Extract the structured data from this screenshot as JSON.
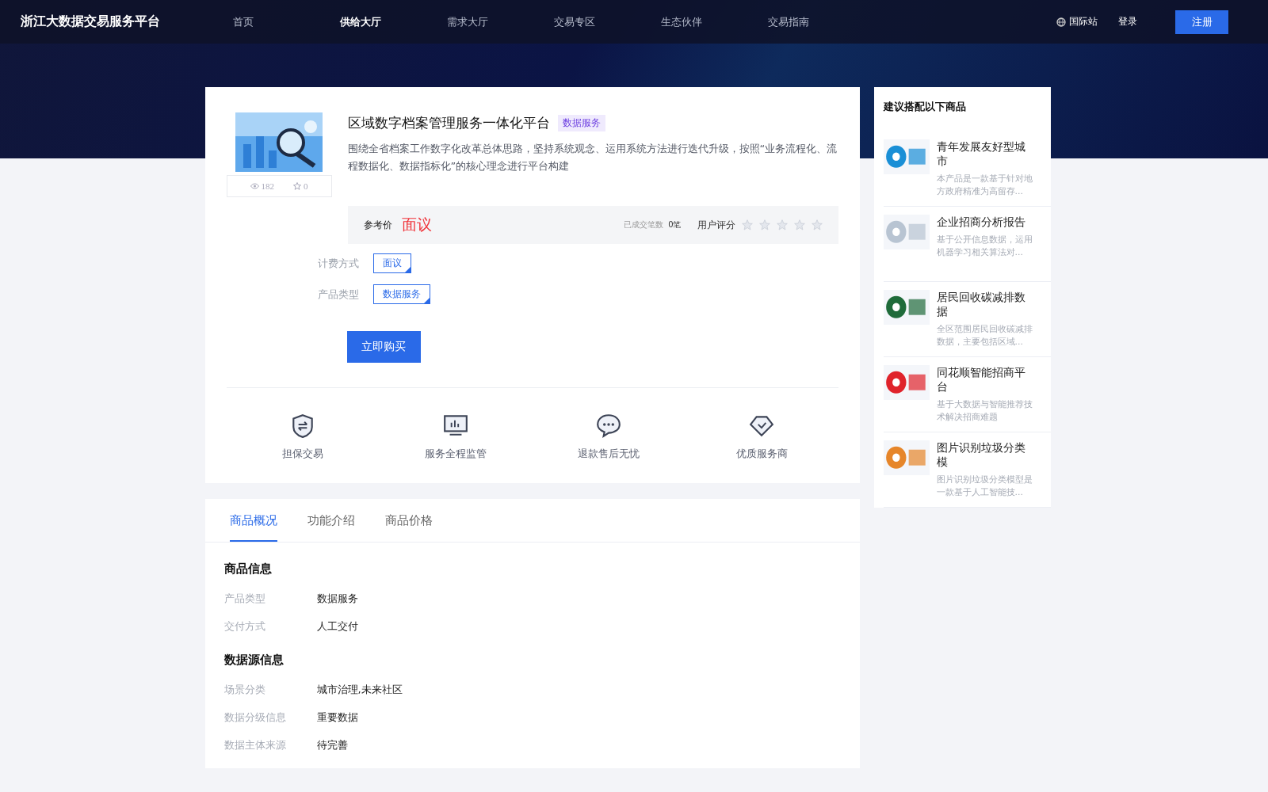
{
  "header": {
    "logo": "浙江大数据交易服务平台",
    "nav": [
      {
        "label": "首页",
        "selected": false
      },
      {
        "label": "供给大厅",
        "selected": true
      },
      {
        "label": "需求大厅",
        "selected": false
      },
      {
        "label": "交易专区",
        "selected": false
      },
      {
        "label": "生态伙伴",
        "selected": false
      },
      {
        "label": "交易指南",
        "selected": false
      }
    ],
    "intl": "国际站",
    "login": "登录",
    "register": "注册"
  },
  "product": {
    "views": "182",
    "favorites": "0",
    "title": "区域数字档案管理服务一体化平台",
    "badge": "数据服务",
    "description": "围绕全省档案工作数字化改革总体思路，坚持系统观念、运用系统方法进行迭代升级，按照“业务流程化、流程数据化、数据指标化”的核心理念进行平台构建",
    "price_label": "参考价",
    "price": "面议",
    "deals_label": "已成交笔数",
    "deals": "0笔",
    "rating_label": "用户评分",
    "stars": 0,
    "options": [
      {
        "label": "计费方式",
        "value": "面议"
      },
      {
        "label": "产品类型",
        "value": "数据服务"
      }
    ],
    "buy": "立即购买",
    "features": [
      {
        "kind": "shield",
        "label": "担保交易"
      },
      {
        "kind": "monitor",
        "label": "服务全程监管"
      },
      {
        "kind": "chat",
        "label": "退款售后无忧"
      },
      {
        "kind": "diamond",
        "label": "优质服务商"
      }
    ]
  },
  "details": {
    "tabs": [
      {
        "label": "商品概况",
        "selected": true
      },
      {
        "label": "功能介绍",
        "selected": false
      },
      {
        "label": "商品价格",
        "selected": false
      }
    ],
    "sections": [
      {
        "title": "商品信息",
        "rows": [
          {
            "label": "产品类型",
            "value": "数据服务"
          },
          {
            "label": "交付方式",
            "value": "人工交付"
          }
        ]
      },
      {
        "title": "数据源信息",
        "rows": [
          {
            "label": "场景分类",
            "value": "城市治理,未来社区"
          },
          {
            "label": "数据分级信息",
            "value": "重要数据"
          },
          {
            "label": "数据主体来源",
            "value": "待完善"
          }
        ]
      }
    ]
  },
  "sidebar": {
    "title": "建议搭配以下商品",
    "items": [
      {
        "title": "青年发展友好型城市",
        "description": "本产品是一款基于针对地方政府精准为高留存..."
      },
      {
        "title": "企业招商分析报告",
        "description": "基于公开信息数据，运用机器学习相关算法对..."
      },
      {
        "title": "居民回收碳减排数据",
        "description": "全区范围居民回收碳减排数据，主要包括区域..."
      },
      {
        "title": "同花顺智能招商平台",
        "description": "基于大数据与智能推荐技术解决招商难题"
      },
      {
        "title": "图片识别垃圾分类模",
        "description": "图片识别垃圾分类模型是一款基于人工智能技..."
      }
    ]
  }
}
